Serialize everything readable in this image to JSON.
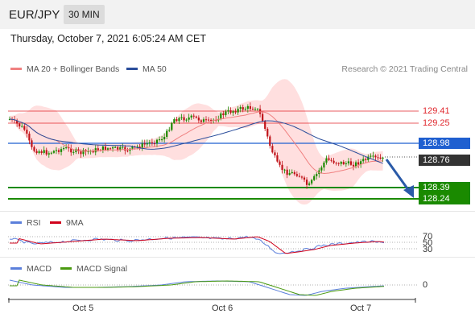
{
  "header": {
    "pair": "EUR/JPY",
    "timeframe": "30 MIN"
  },
  "datetime": "Thursday, October 7, 2021 6:05:24 AM CET",
  "legend": {
    "ma20": "MA 20 + Bollinger Bands",
    "ma50": "MA 50",
    "credit": "Research © 2021 Trading Central"
  },
  "levels": {
    "r2": "129.41",
    "r1": "129.25",
    "pivot": "128.98",
    "last": "128.76",
    "s1": "128.39",
    "s2": "128.24"
  },
  "rsi": {
    "label": "RSI",
    "signal_label": "9MA",
    "levels": [
      "70",
      "50",
      "30"
    ]
  },
  "macd": {
    "label": "MACD",
    "signal_label": "MACD Signal",
    "zero": "0"
  },
  "xaxis": [
    "Oct 5",
    "Oct 6",
    "Oct 7"
  ],
  "colors": {
    "resistance": "#e0262c",
    "pivot": "#1f5fd0",
    "support": "#1a8a00",
    "last_bg": "#333333",
    "rsi": "#5b7fdb",
    "rsi_ma": "#d0021b",
    "macd": "#5b7fdb",
    "macd_signal": "#4a9a10",
    "bollinger": "#ffd6d6",
    "ma20": "#f08080",
    "ma50": "#2a4d9b"
  }
}
